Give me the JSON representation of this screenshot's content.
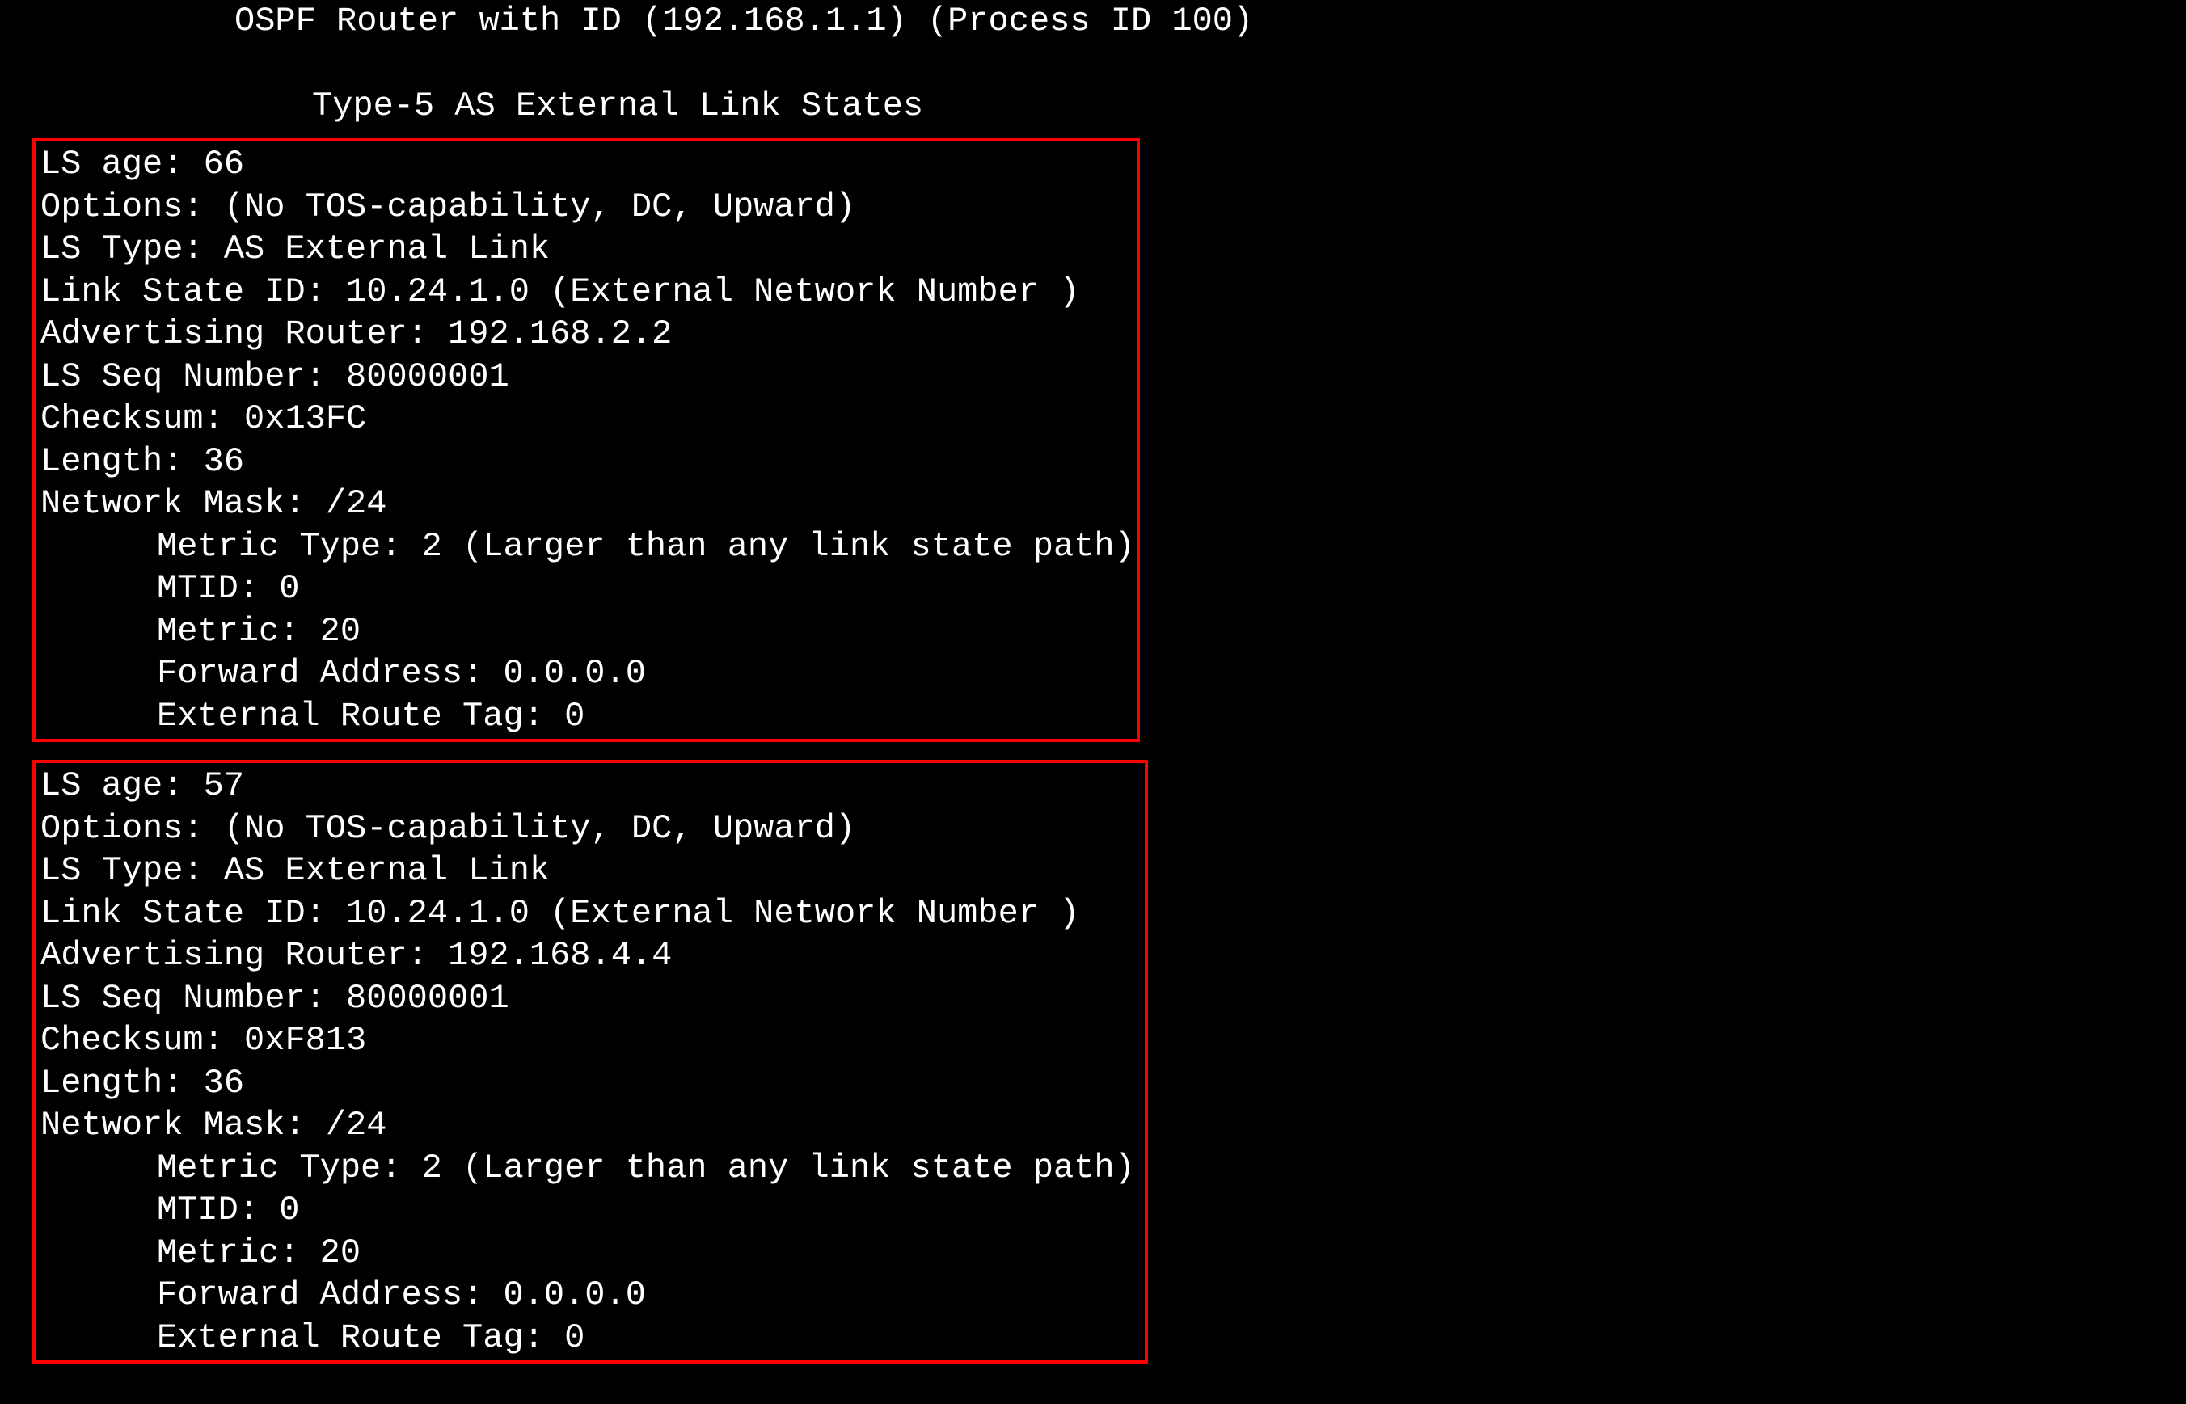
{
  "header": {
    "router_line": "OSPF Router with ID (192.168.1.1) (Process ID 100)",
    "section_title": "Type-5 AS External Link States"
  },
  "lsa": [
    {
      "ls_age": "LS age: 66",
      "options": "Options: (No TOS-capability, DC, Upward)",
      "ls_type": "LS Type: AS External Link",
      "link_state_id": "Link State ID: 10.24.1.0 (External Network Number )",
      "advertising_router": "Advertising Router: 192.168.2.2",
      "ls_seq_number": "LS Seq Number: 80000001",
      "checksum": "Checksum: 0x13FC",
      "length": "Length: 36",
      "network_mask": "Network Mask: /24",
      "metric_type": "Metric Type: 2 (Larger than any link state path)",
      "mtid": "MTID: 0",
      "metric": "Metric: 20",
      "forward_address": "Forward Address: 0.0.0.0",
      "external_route_tag": "External Route Tag: 0"
    },
    {
      "ls_age": "LS age: 57",
      "options": "Options: (No TOS-capability, DC, Upward)",
      "ls_type": "LS Type: AS External Link",
      "link_state_id": "Link State ID: 10.24.1.0 (External Network Number )",
      "advertising_router": "Advertising Router: 192.168.4.4",
      "ls_seq_number": "LS Seq Number: 80000001",
      "checksum": "Checksum: 0xF813",
      "length": "Length: 36",
      "network_mask": "Network Mask: /24",
      "metric_type": "Metric Type: 2 (Larger than any link state path)",
      "mtid": "MTID: 0",
      "metric": "Metric: 20",
      "forward_address": "Forward Address: 0.0.0.0",
      "external_route_tag": "External Route Tag: 0"
    }
  ]
}
